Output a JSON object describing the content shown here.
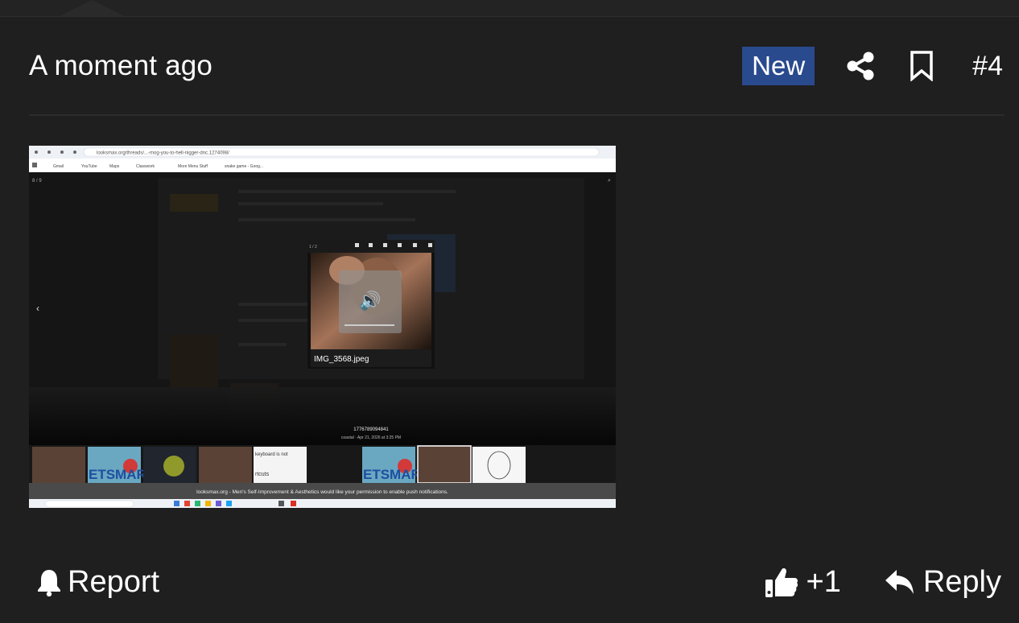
{
  "post": {
    "timestamp": "A moment ago",
    "badge": "New",
    "number": "#4"
  },
  "icons": {
    "share": "share-icon",
    "bookmark": "bookmark-icon",
    "report": "bell-icon",
    "like": "thumbs-up-icon",
    "reply": "reply-icon"
  },
  "attachment": {
    "browser_url": "looksmax.org/threads/...-mog-you-to-hell-nigger-dnc.1274098/",
    "bookmarks": [
      "Gmail",
      "YouTube",
      "Maps",
      "Classwork",
      "More Menu Stuff",
      "snake game - Goog..."
    ],
    "counter": "8 / 9",
    "popup_counter": "1 / 2",
    "popup_filename": "IMG_3568.jpeg",
    "photo_id": "1776789094841",
    "photo_caption": "coastal · Apr 21, 2026 at 3:25 PM",
    "notification": "looksmax.org - Men's Self-Improvement & Aesthetics would like your permission to enable push notifications.",
    "thumb_text": "ETSMAR",
    "thumb_text2": "keyboard is not",
    "thumb_text3": "rtcuts"
  },
  "footer": {
    "report": "Report",
    "likes": "+1",
    "reply": "Reply"
  },
  "colors": {
    "background": "#1f1f1f",
    "badge": "#2a4a8e",
    "text": "#ffffff"
  }
}
